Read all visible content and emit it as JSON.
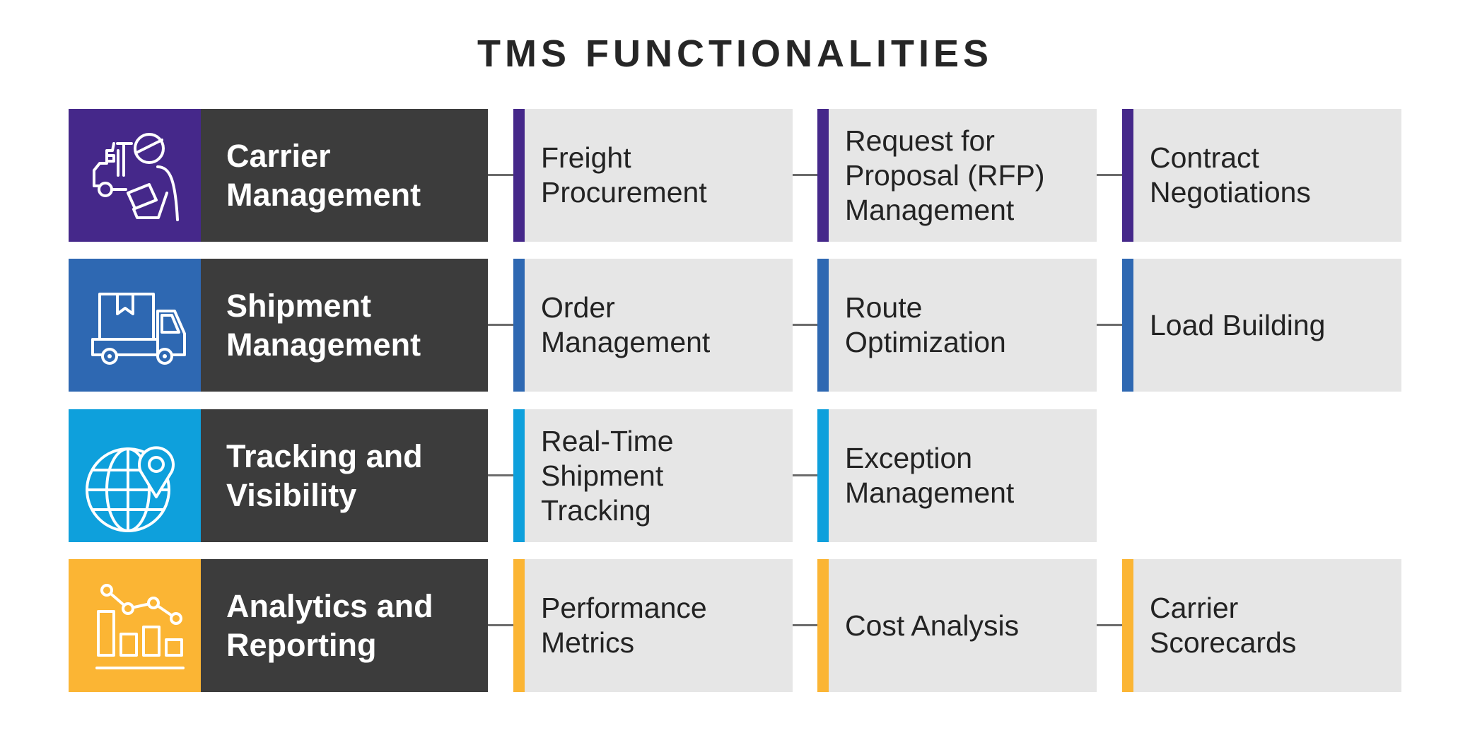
{
  "title": "TMS FUNCTIONALITIES",
  "colors": {
    "purple": "#45288a",
    "blue": "#2e68b2",
    "cyan": "#0ea0dc",
    "yellow": "#fbb534",
    "main_card_bg": "#3c3c3c",
    "sub_box_bg": "#e6e6e6",
    "connector": "#6b6b6b"
  },
  "rows": [
    {
      "label": "Carrier\nManagement",
      "icon": "truck-driver-clipboard-icon",
      "accent": "#45288a",
      "items": [
        "Freight\nProcurement",
        "Request for\nProposal (RFP)\nManagement",
        "Contract\nNegotiations"
      ]
    },
    {
      "label": "Shipment\nManagement",
      "icon": "delivery-truck-box-icon",
      "accent": "#2e68b2",
      "items": [
        "Order\nManagement",
        "Route\nOptimization",
        "Load Building"
      ]
    },
    {
      "label": "Tracking and\nVisibility",
      "icon": "globe-location-pin-icon",
      "accent": "#0ea0dc",
      "items": [
        "Real-Time\nShipment\nTracking",
        "Exception\nManagement"
      ]
    },
    {
      "label": "Analytics and\nReporting",
      "icon": "bar-line-chart-icon",
      "accent": "#fbb534",
      "items": [
        "Performance\nMetrics",
        "Cost Analysis",
        "Carrier\nScorecards"
      ]
    }
  ]
}
